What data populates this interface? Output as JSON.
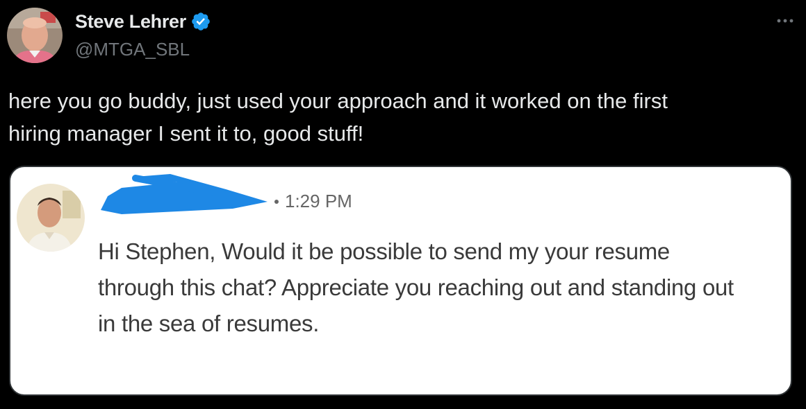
{
  "author": {
    "name": "Steve Lehrer",
    "handle": "@MTGA_SBL",
    "avatar_icon": "person-avatar",
    "verified_icon": "verified-badge-icon",
    "verified_color": "#1d9bf0"
  },
  "more_icon": "more-dots-icon",
  "tweet": {
    "text": "here you go buddy, just used your approach and it worked on the first\nhiring manager I sent it to, good stuff!"
  },
  "embedded_message": {
    "avatar_icon": "person-avatar",
    "sender_redacted_color": "#1e88e5",
    "timestamp": "1:29 PM",
    "text": "Hi Stephen, Would it be possible to send my your resume through this chat? Appreciate you reaching out and standing out in the sea of resumes."
  },
  "colors": {
    "background": "#000000",
    "text_primary": "#e7e9ea",
    "text_secondary": "#71767b"
  }
}
